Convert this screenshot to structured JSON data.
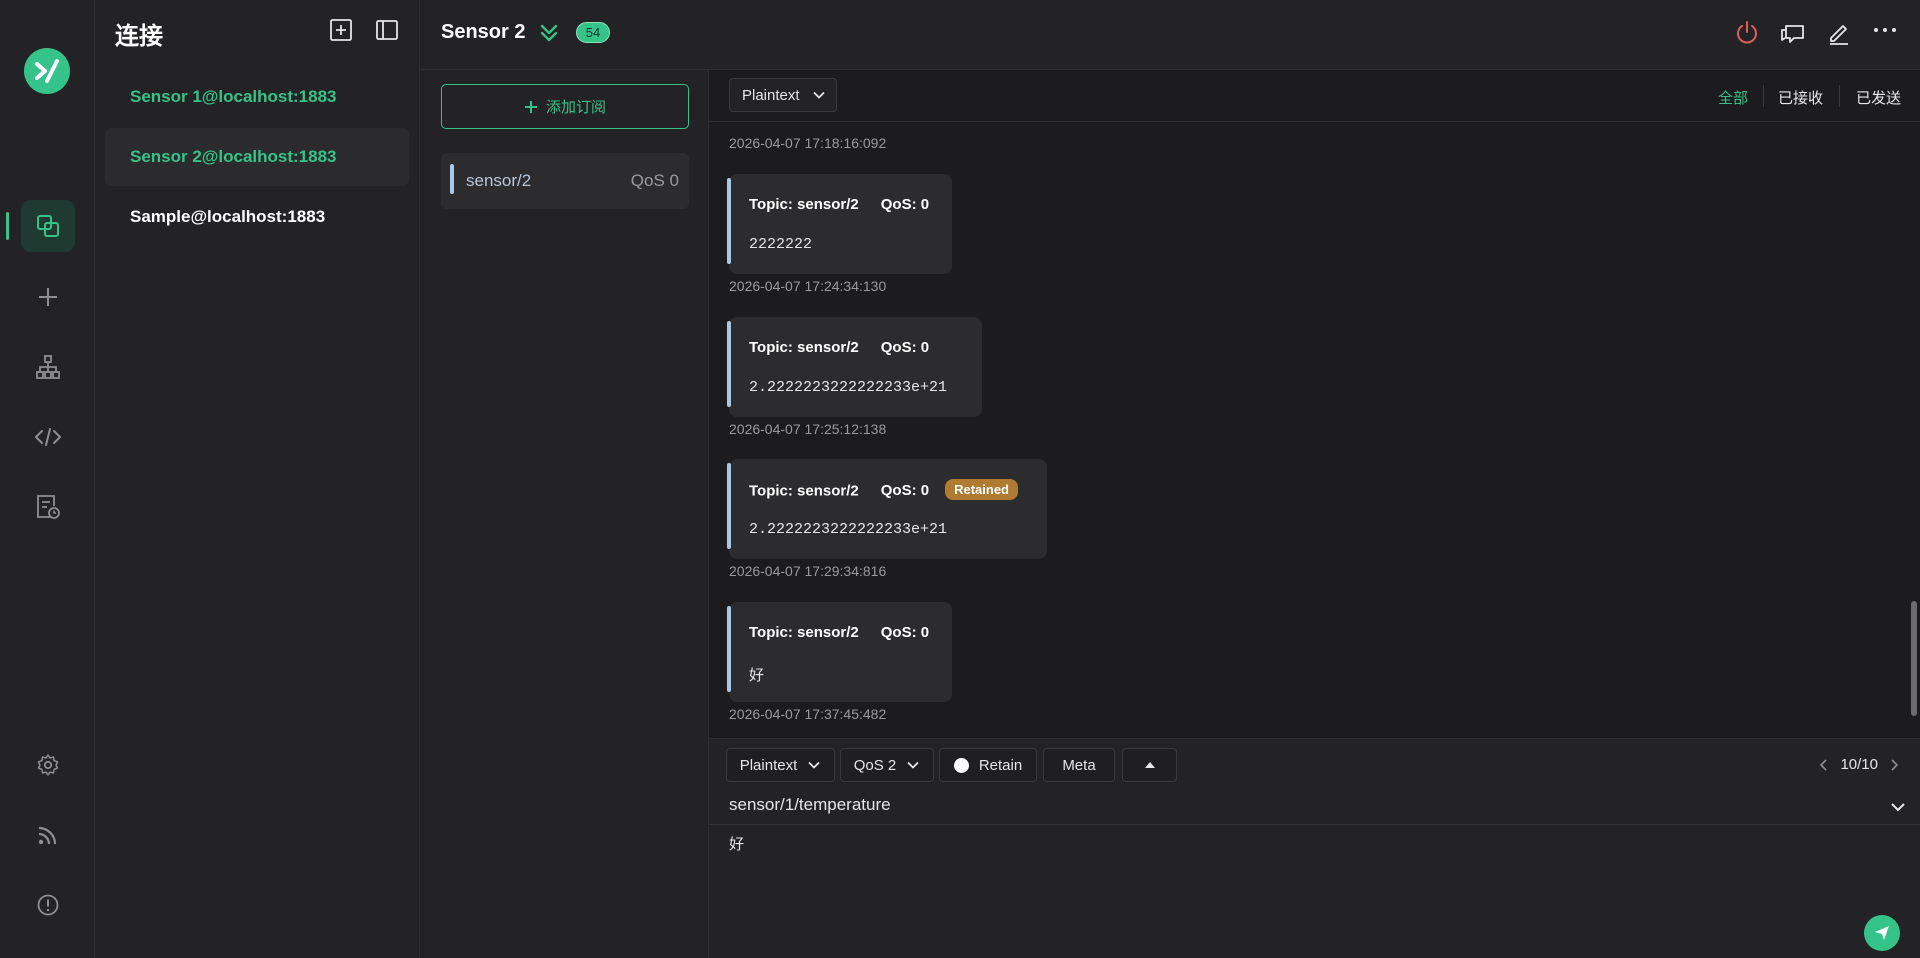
{
  "colors": {
    "accent": "#34c388",
    "danger": "#e05c5c",
    "retained": "#b07a30",
    "topic_bar": "#a9c7e6"
  },
  "rail": {
    "icons": [
      "logo",
      "connections-icon",
      "plus-icon",
      "topology-icon",
      "script-icon",
      "log-icon",
      "settings-icon",
      "rss-icon",
      "info-icon"
    ]
  },
  "connections": {
    "title": "连接",
    "items": [
      {
        "label": "Sensor 1@localhost:1883"
      },
      {
        "label": "Sensor 2@localhost:1883"
      },
      {
        "label": "Sample@localhost:1883"
      }
    ]
  },
  "header": {
    "title": "Sensor 2",
    "badge": "54"
  },
  "subscriptions": {
    "add_label": "添加订阅",
    "items": [
      {
        "topic": "sensor/2",
        "qos": "QoS 0"
      }
    ]
  },
  "messages": {
    "format": "Plaintext",
    "filters": [
      "全部",
      "已接收",
      "已发送"
    ],
    "first_time": "2026-04-07 17:18:16:092",
    "list": [
      {
        "topic_label": "Topic: sensor/2",
        "qos_label": "QoS: 0",
        "payload": "2222222",
        "time": "2026-04-07 17:24:34:130",
        "retained": ""
      },
      {
        "topic_label": "Topic: sensor/2",
        "qos_label": "QoS: 0",
        "payload": "2.2222223222222233e+21",
        "time": "2026-04-07 17:25:12:138",
        "retained": ""
      },
      {
        "topic_label": "Topic: sensor/2",
        "qos_label": "QoS: 0",
        "payload": "2.2222223222222233e+21",
        "time": "2026-04-07 17:29:34:816",
        "retained": "Retained"
      },
      {
        "topic_label": "Topic: sensor/2",
        "qos_label": "QoS: 0",
        "payload": "好",
        "time": "2026-04-07 17:37:45:482",
        "retained": ""
      }
    ]
  },
  "composer": {
    "format": "Plaintext",
    "qos": "QoS 2",
    "retain_label": "Retain",
    "meta_label": "Meta",
    "pager": "10/10",
    "topic": "sensor/1/temperature",
    "payload": "好"
  }
}
